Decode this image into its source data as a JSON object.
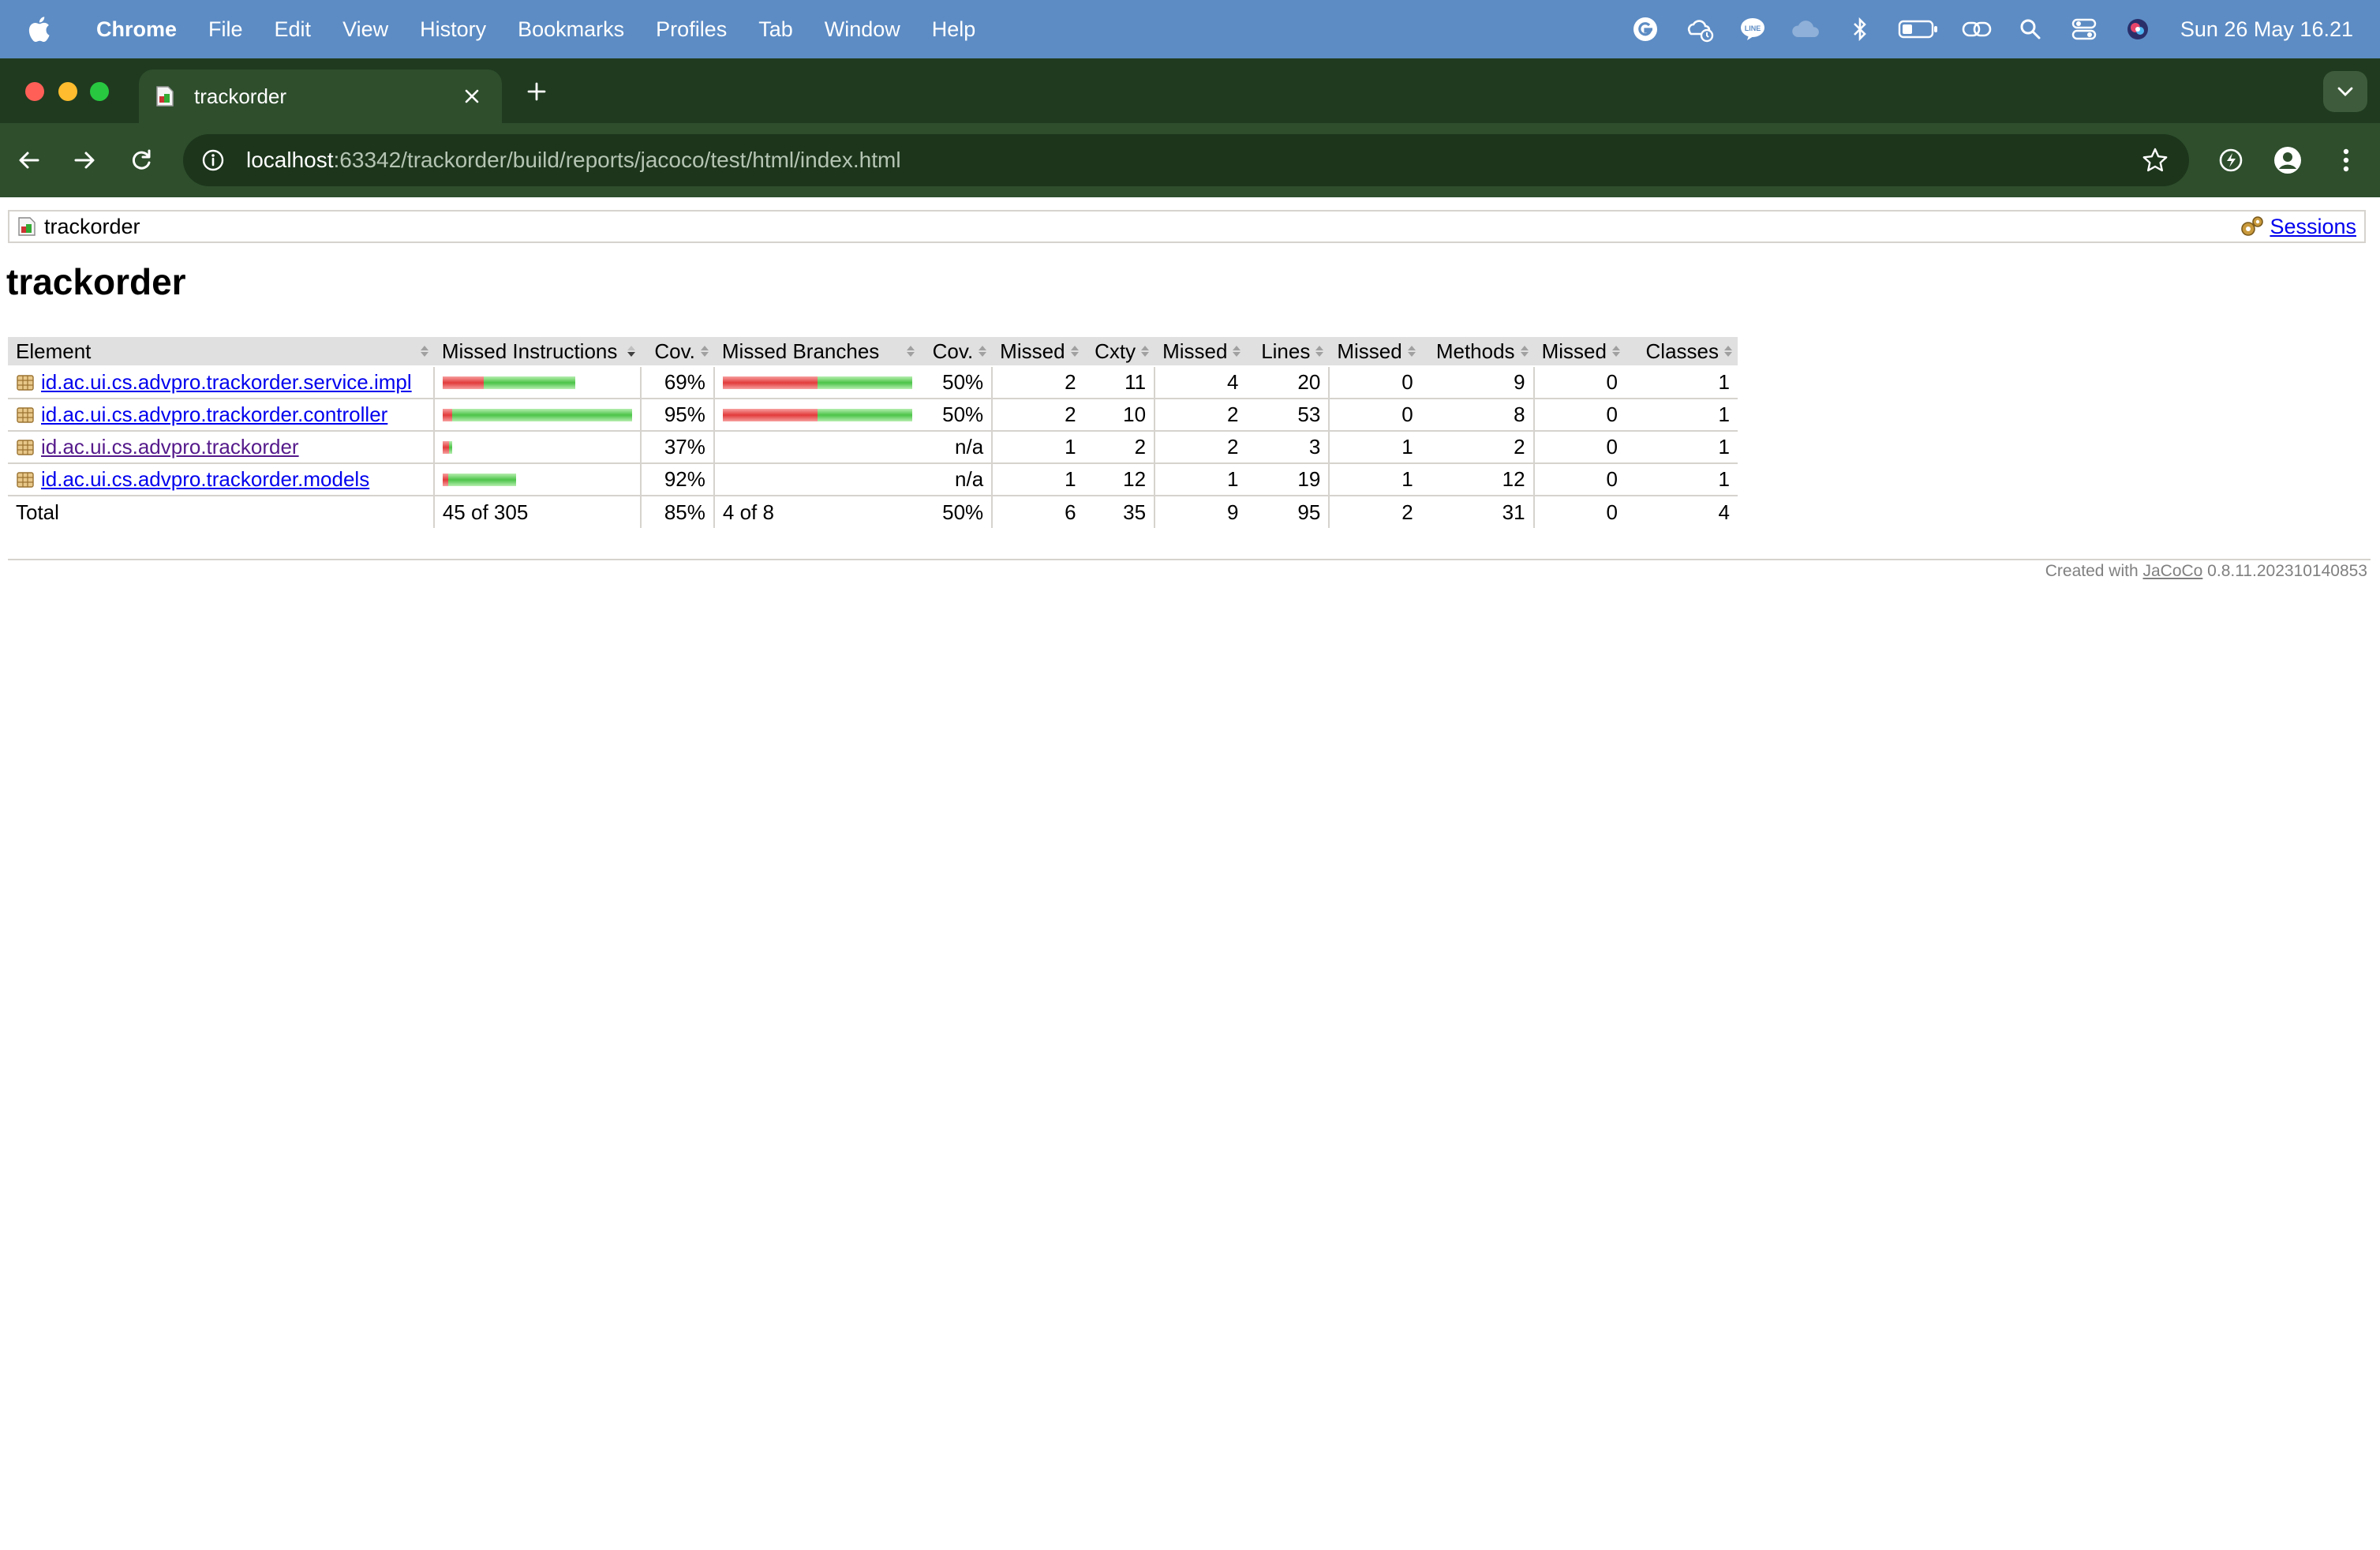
{
  "menubar": {
    "app_name": "Chrome",
    "items": [
      "File",
      "Edit",
      "View",
      "History",
      "Bookmarks",
      "Profiles",
      "Tab",
      "Window",
      "Help"
    ],
    "clock": "Sun 26 May  16.21",
    "battery_level": 0.35
  },
  "browser": {
    "tab_title": "trackorder",
    "url_host": "localhost",
    "url_path": ":63342/trackorder/build/reports/jacoco/test/html/index.html"
  },
  "breadcrumb": {
    "current": "trackorder",
    "sessions_label": "Sessions"
  },
  "page": {
    "title": "trackorder"
  },
  "table": {
    "headers": [
      "Element",
      "Missed Instructions",
      "Cov.",
      "Missed Branches",
      "Cov.",
      "Missed",
      "Cxty",
      "Missed",
      "Lines",
      "Missed",
      "Methods",
      "Missed",
      "Classes"
    ],
    "rows": [
      {
        "element": "id.ac.ui.cs.advpro.trackorder.service.impl",
        "instr_missed": 0.31,
        "instr_covered": 0.69,
        "instr_bar_scale": 0.7,
        "instr_cov": "69%",
        "branch_missed": 0.5,
        "branch_covered": 0.5,
        "branch_bar_scale": 1.0,
        "branch_cov": "50%",
        "cxty_missed": "2",
        "cxty": "11",
        "lines_missed": "4",
        "lines": "20",
        "methods_missed": "0",
        "methods": "9",
        "classes_missed": "0",
        "classes": "1"
      },
      {
        "element": "id.ac.ui.cs.advpro.trackorder.controller",
        "instr_missed": 0.05,
        "instr_covered": 0.95,
        "instr_bar_scale": 1.0,
        "instr_cov": "95%",
        "branch_missed": 0.5,
        "branch_covered": 0.5,
        "branch_bar_scale": 1.0,
        "branch_cov": "50%",
        "cxty_missed": "2",
        "cxty": "10",
        "lines_missed": "2",
        "lines": "53",
        "methods_missed": "0",
        "methods": "8",
        "classes_missed": "0",
        "classes": "1"
      },
      {
        "element": "id.ac.ui.cs.advpro.trackorder",
        "instr_missed": 0.63,
        "instr_covered": 0.37,
        "instr_bar_scale": 0.05,
        "instr_cov": "37%",
        "branch_missed": 0,
        "branch_covered": 0,
        "branch_bar_scale": 0,
        "branch_cov": "n/a",
        "cxty_missed": "1",
        "cxty": "2",
        "lines_missed": "2",
        "lines": "3",
        "methods_missed": "1",
        "methods": "2",
        "classes_missed": "0",
        "classes": "1"
      },
      {
        "element": "id.ac.ui.cs.advpro.trackorder.models",
        "instr_missed": 0.08,
        "instr_covered": 0.92,
        "instr_bar_scale": 0.39,
        "instr_cov": "92%",
        "branch_missed": 0,
        "branch_covered": 0,
        "branch_bar_scale": 0,
        "branch_cov": "n/a",
        "cxty_missed": "1",
        "cxty": "12",
        "lines_missed": "1",
        "lines": "19",
        "methods_missed": "1",
        "methods": "12",
        "classes_missed": "0",
        "classes": "1"
      }
    ],
    "total": {
      "label": "Total",
      "instr": "45 of 305",
      "instr_cov": "85%",
      "branch": "4 of 8",
      "branch_cov": "50%",
      "cxty_missed": "6",
      "cxty": "35",
      "lines_missed": "9",
      "lines": "95",
      "methods_missed": "2",
      "methods": "31",
      "classes_missed": "0",
      "classes": "4"
    }
  },
  "footer": {
    "prefix": "Created with ",
    "link": "JaCoCo",
    "version": " 0.8.11.202310140853"
  },
  "colors": {
    "menubar": "#5d8cc4",
    "tabstrip": "#1f3a1f",
    "toolbar": "#2e4e2c",
    "bar_missed": "#e23b3b",
    "bar_covered": "#4cc448"
  }
}
